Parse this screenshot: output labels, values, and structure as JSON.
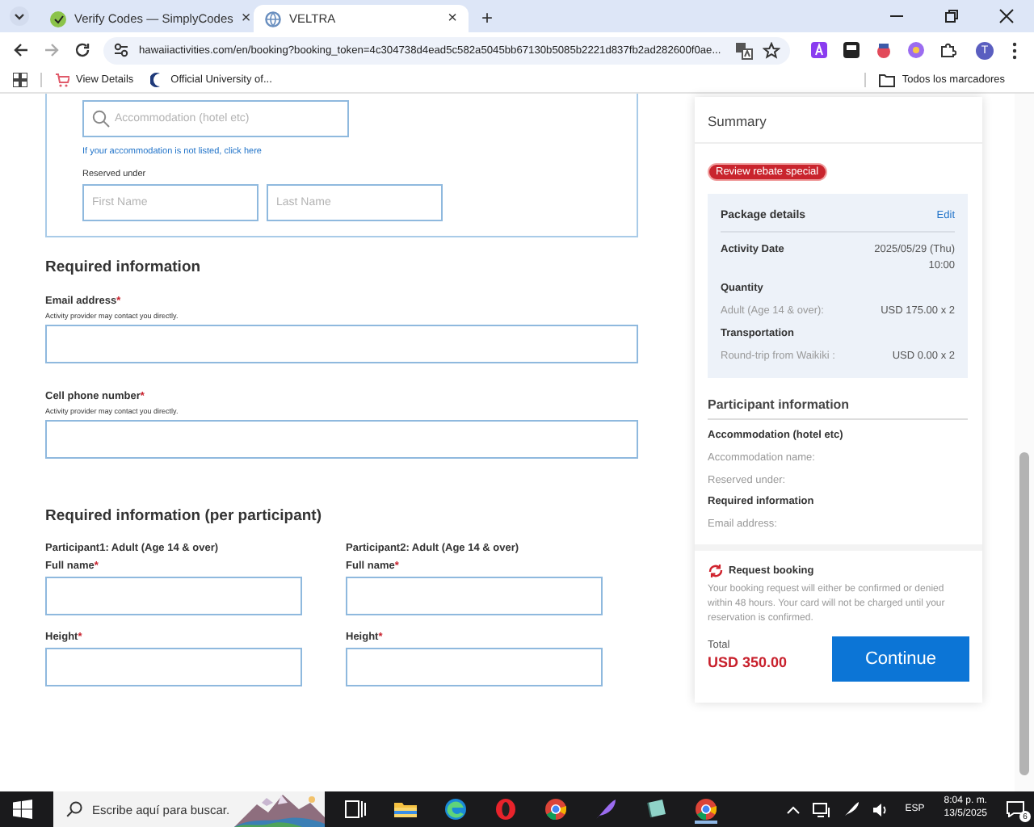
{
  "browser": {
    "tabs": [
      {
        "title": "Verify Codes — SimplyCodes",
        "selected": false,
        "close": "×"
      },
      {
        "title": "VELTRA",
        "selected": true,
        "close": "×"
      }
    ],
    "new_tab": "+",
    "url": "hawaiiactivities.com/en/booking?booking_token=4c304738d4ead5c582a5045bb67130b5085b2221d837fb2ad282600f0ae...",
    "profile": "T",
    "bookmarks": [
      {
        "title": "View Details"
      },
      {
        "title": "Official University of..."
      }
    ],
    "all_bookmarks": "Todos los marcadores"
  },
  "accommodation": {
    "search_placeholder": "Accommodation (hotel etc)",
    "not_listed_link": "If your accommodation is not listed, click here",
    "reserved_label": "Reserved under",
    "first_placeholder": "First Name",
    "last_placeholder": "Last Name"
  },
  "required_mark": "*",
  "required": {
    "title": "Required information",
    "fields": [
      {
        "label": "Email address",
        "required": true,
        "hint": "Activity provider may contact you directly."
      },
      {
        "label": "Cell phone number",
        "required": true,
        "hint": "Activity provider may contact you directly."
      }
    ]
  },
  "per_participant": {
    "title": "Required information (per participant)",
    "participants": [
      {
        "heading": "Participant1: Adult (Age 14 & over)",
        "fields": [
          {
            "label": "Full name",
            "required": true
          },
          {
            "label": "Height",
            "required": true
          }
        ]
      },
      {
        "heading": "Participant2: Adult (Age 14 & over)",
        "fields": [
          {
            "label": "Full name",
            "required": true
          },
          {
            "label": "Height",
            "required": true
          }
        ]
      }
    ]
  },
  "summary": {
    "title": "Summary",
    "badge": "Review rebate special",
    "package": {
      "title": "Package details",
      "edit": "Edit",
      "rows": [
        {
          "kind": "pair",
          "label": "Activity Date",
          "value": "2025/05/29 (Thu) 10:00"
        },
        {
          "kind": "heading",
          "label": "Quantity"
        },
        {
          "kind": "detail",
          "label": "Adult (Age 14 & over):",
          "value": "USD 175.00 x 2"
        },
        {
          "kind": "heading",
          "label": "Transportation"
        },
        {
          "kind": "detail",
          "label": "Round-trip from Waikiki :",
          "value": "USD 0.00 x 2"
        }
      ]
    },
    "participant_info": [
      {
        "kind": "title",
        "text": "Participant information"
      },
      {
        "kind": "heading",
        "text": "Accommodation (hotel etc)"
      },
      {
        "kind": "item",
        "text": "Accommodation name:"
      },
      {
        "kind": "item",
        "text": "Reserved under:"
      },
      {
        "kind": "heading",
        "text": "Required information"
      },
      {
        "kind": "item",
        "text": "Email address:"
      }
    ],
    "request": {
      "title": "Request booking",
      "text": "Your booking request will either be confirmed or denied within 48 hours. Your card will not be charged until your reservation is confirmed."
    },
    "total_label": "Total",
    "total": "USD 350.00",
    "button": "Continue"
  },
  "taskbar": {
    "search_placeholder": "Escribe aquí para buscar.",
    "language": "ESP",
    "time": "8:04 p. m.",
    "date": "13/5/2025",
    "notifications": "6"
  }
}
